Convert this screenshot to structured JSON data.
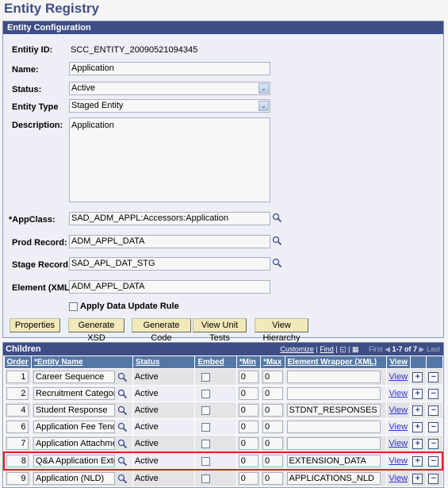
{
  "page": {
    "title": "Entity Registry"
  },
  "config": {
    "header": "Entity Configuration",
    "entity_id_label": "Entitiy ID:",
    "entity_id_value": "SCC_ENTITY_20090521094345",
    "name_label": "Name:",
    "name_value": "Application",
    "status_label": "Status:",
    "status_value": "Active",
    "entity_type_label": "Entity Type",
    "entity_type_value": "Staged Entity",
    "description_label": "Description:",
    "description_value": "Application",
    "appclass_label": "*AppClass:",
    "appclass_value": "SAD_ADM_APPL:Accessors:Application",
    "prod_record_label": "Prod Record:",
    "prod_record_value": "ADM_APPL_DATA",
    "stage_record_label": "Stage Record:",
    "stage_record_value": "SAD_APL_DAT_STG",
    "element_label": "Element (XML):",
    "element_value": "ADM_APPL_DATA",
    "apply_rule_label": "Apply Data Update Rule",
    "apply_rule_checked": false,
    "buttons": [
      "Properties",
      "Generate XSD",
      "Generate Code",
      "View Unit Tests",
      "View Hierarchy"
    ]
  },
  "children": {
    "title": "Children",
    "tools": {
      "customize": "Customize",
      "find": "Find",
      "sep": "|",
      "first": "First",
      "range": "1-7 of 7",
      "last": "Last"
    },
    "columns": [
      "Order",
      "*Entity Name",
      "Status",
      "Embed",
      "*Min",
      "*Max",
      "Element Wrapper (XML)",
      "View",
      "",
      ""
    ],
    "rows": [
      {
        "order": "1",
        "name": "Career Sequence",
        "status": "Active",
        "embed": false,
        "min": "0",
        "max": "0",
        "wrapper": "",
        "view": "View"
      },
      {
        "order": "2",
        "name": "Recruitment Category",
        "status": "Active",
        "embed": false,
        "min": "0",
        "max": "0",
        "wrapper": "",
        "view": "View"
      },
      {
        "order": "4",
        "name": "Student Response",
        "status": "Active",
        "embed": false,
        "min": "0",
        "max": "0",
        "wrapper": "STDNT_RESPONSES",
        "view": "View"
      },
      {
        "order": "6",
        "name": "Application Fee Tender",
        "status": "Active",
        "embed": false,
        "min": "0",
        "max": "0",
        "wrapper": "",
        "view": "View"
      },
      {
        "order": "7",
        "name": "Application Attachment",
        "status": "Active",
        "embed": false,
        "min": "0",
        "max": "0",
        "wrapper": "",
        "view": "View"
      },
      {
        "order": "8",
        "name": "Q&A Application Extens",
        "status": "Active",
        "embed": false,
        "min": "0",
        "max": "0",
        "wrapper": "EXTENSION_DATA",
        "view": "View",
        "highlighted": true
      },
      {
        "order": "9",
        "name": "Application (NLD)",
        "status": "Active",
        "embed": false,
        "min": "0",
        "max": "0",
        "wrapper": "APPLICATIONS_NLD",
        "view": "View"
      }
    ],
    "add_symbol": "+",
    "remove_symbol": "−"
  },
  "colors": {
    "header_bg": "#3e4d85",
    "column_bg": "#5577a5",
    "button_bg": "#f2e9b8",
    "highlight": "#e02020"
  }
}
